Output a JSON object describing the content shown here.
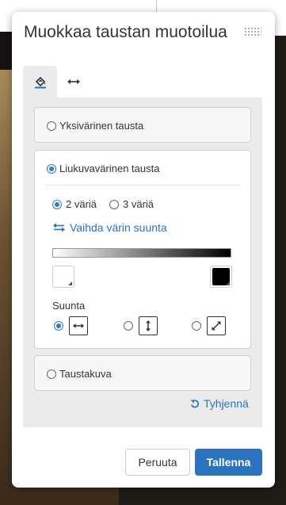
{
  "dialog": {
    "title": "Muokkaa taustan muotoilua"
  },
  "tabs": [
    {
      "name": "fill",
      "icon": "paint-bucket-icon",
      "active": true
    },
    {
      "name": "size",
      "icon": "horizontal-arrows-icon",
      "active": false
    }
  ],
  "options": {
    "solid_label": "Yksivärinen tausta",
    "gradient_label": "Liukuvavärinen tausta",
    "image_label": "Taustakuva",
    "selected": "gradient"
  },
  "gradient": {
    "colors_2_label": "2 väriä",
    "colors_3_label": "3 väriä",
    "selected_colors": 2,
    "swap_label": "Vaihda värin suunta",
    "start_color": "#ffffff",
    "end_color": "#000000",
    "direction_label": "Suunta",
    "direction_options": [
      "horizontal",
      "vertical",
      "diagonal"
    ],
    "selected_direction": "horizontal"
  },
  "clear_label": "Tyhjennä",
  "footer": {
    "cancel_label": "Peruuta",
    "save_label": "Tallenna"
  },
  "colors": {
    "accent": "#2b73bc"
  }
}
